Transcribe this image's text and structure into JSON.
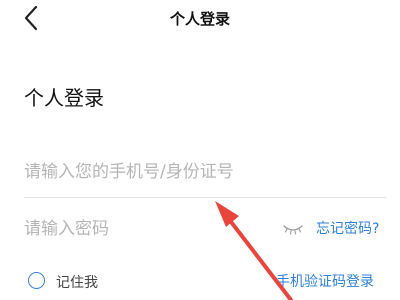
{
  "navbar": {
    "back_icon": "chevron-left-icon",
    "title": "个人登录"
  },
  "page": {
    "heading": "个人登录"
  },
  "form": {
    "account_placeholder": "请输入您的手机号/身份证号",
    "account_value": "",
    "password_placeholder": "请输入密码",
    "password_value": "",
    "password_toggle_icon": "eye-closed-icon",
    "forgot_password": "忘记密码?"
  },
  "options": {
    "remember_me": "记住我",
    "sms_login": "手机验证码登录"
  },
  "colors": {
    "accent": "#2f7fd6",
    "annotation": "#e8453c",
    "placeholder": "#b5b5b5"
  }
}
